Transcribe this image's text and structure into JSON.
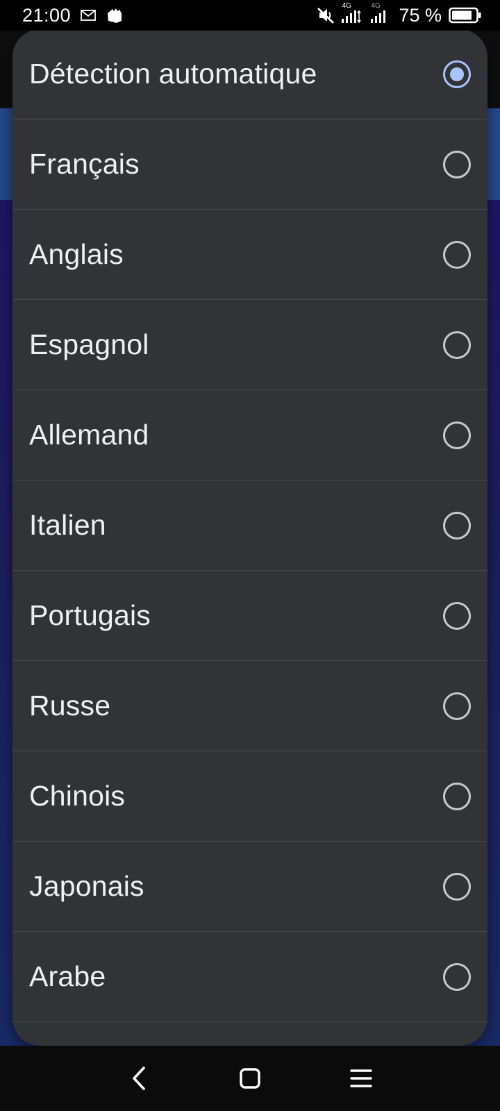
{
  "status_bar": {
    "time": "21:00",
    "battery_percent": "75 %",
    "network_label_1": "4G",
    "network_label_2": "4G",
    "icons": [
      "mail-icon",
      "app-notification-icon",
      "mute-icon",
      "signal-1-icon",
      "signal-2-icon",
      "battery-icon"
    ]
  },
  "dialog": {
    "options": [
      {
        "label": "Détection automatique",
        "selected": true
      },
      {
        "label": "Français",
        "selected": false
      },
      {
        "label": "Anglais",
        "selected": false
      },
      {
        "label": "Espagnol",
        "selected": false
      },
      {
        "label": "Allemand",
        "selected": false
      },
      {
        "label": "Italien",
        "selected": false
      },
      {
        "label": "Portugais",
        "selected": false
      },
      {
        "label": "Russe",
        "selected": false
      },
      {
        "label": "Chinois",
        "selected": false
      },
      {
        "label": "Japonais",
        "selected": false
      },
      {
        "label": "Arabe",
        "selected": false
      }
    ]
  },
  "nav_bar": {
    "buttons": [
      "back-icon",
      "home-icon",
      "recents-icon"
    ]
  },
  "colors": {
    "dialog_bg": "#323337",
    "accent": "#a9c4fb",
    "text": "#eef0f4"
  }
}
